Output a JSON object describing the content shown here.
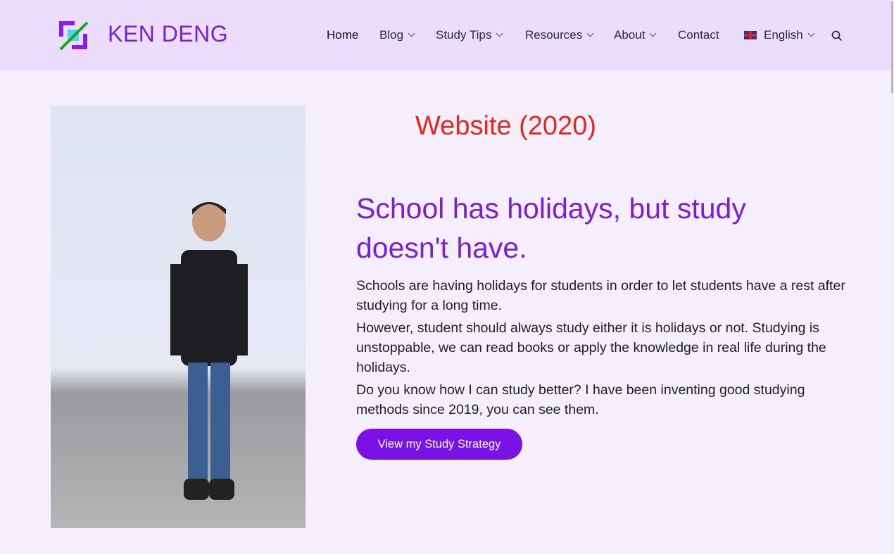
{
  "header": {
    "brand": "KEN DENG",
    "nav": [
      {
        "label": "Home",
        "dropdown": false
      },
      {
        "label": "Blog",
        "dropdown": true
      },
      {
        "label": "Study Tips",
        "dropdown": true
      },
      {
        "label": "Resources",
        "dropdown": true
      },
      {
        "label": "About",
        "dropdown": true
      },
      {
        "label": "Contact",
        "dropdown": false
      }
    ],
    "language": "English",
    "search_icon": "search-icon"
  },
  "colors": {
    "accent": "#7a1fd6",
    "button": "#7a12e8",
    "banner_red": "#e8261a",
    "header_bg": "#ecdcfd",
    "page_bg": "#f5eefd"
  },
  "main": {
    "banner": "Website (2020)",
    "heading": "School has holidays, but study doesn't have.",
    "paragraphs": [
      "Schools are having holidays for students in order to let students have a rest after studying for a long time.",
      "However, student should always study either it is holidays or not. Studying is unstoppable, we can read books or apply the knowledge in real life during the holidays.",
      "Do you know how I can study better? I have been inventing good studying methods since 2019, you can see them."
    ],
    "button": "View my Study Strategy"
  }
}
